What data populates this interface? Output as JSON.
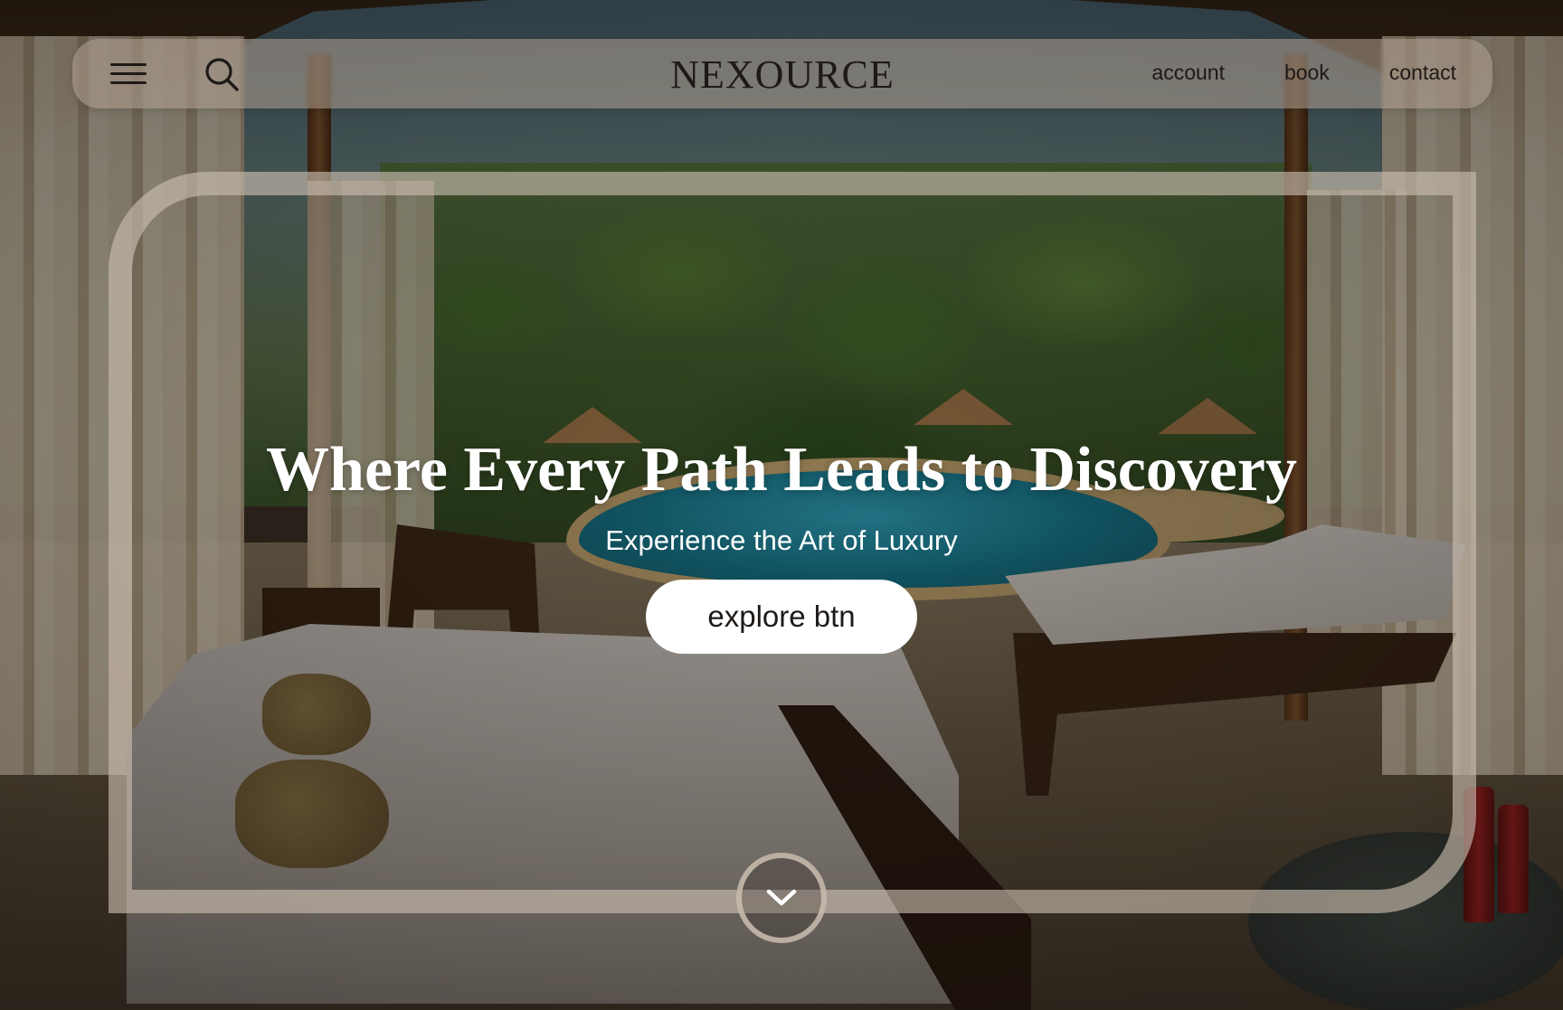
{
  "brand": {
    "name": "NEXOURCE"
  },
  "nav": {
    "links": [
      {
        "label": "account"
      },
      {
        "label": "book"
      },
      {
        "label": "contact"
      }
    ]
  },
  "icons": {
    "menu": "menu-icon",
    "search": "search-icon",
    "scroll": "chevron-down-icon"
  },
  "hero": {
    "title": "Where Every Path Leads to Discovery",
    "subtitle": "Experience the Art of Luxury",
    "cta_label": "explore btn"
  },
  "colors": {
    "nav_bar": "#b0a092",
    "frame": "#cdc0b2",
    "text_dark": "#1e1a17",
    "text_light": "#ffffff",
    "button_bg": "#ffffff"
  }
}
